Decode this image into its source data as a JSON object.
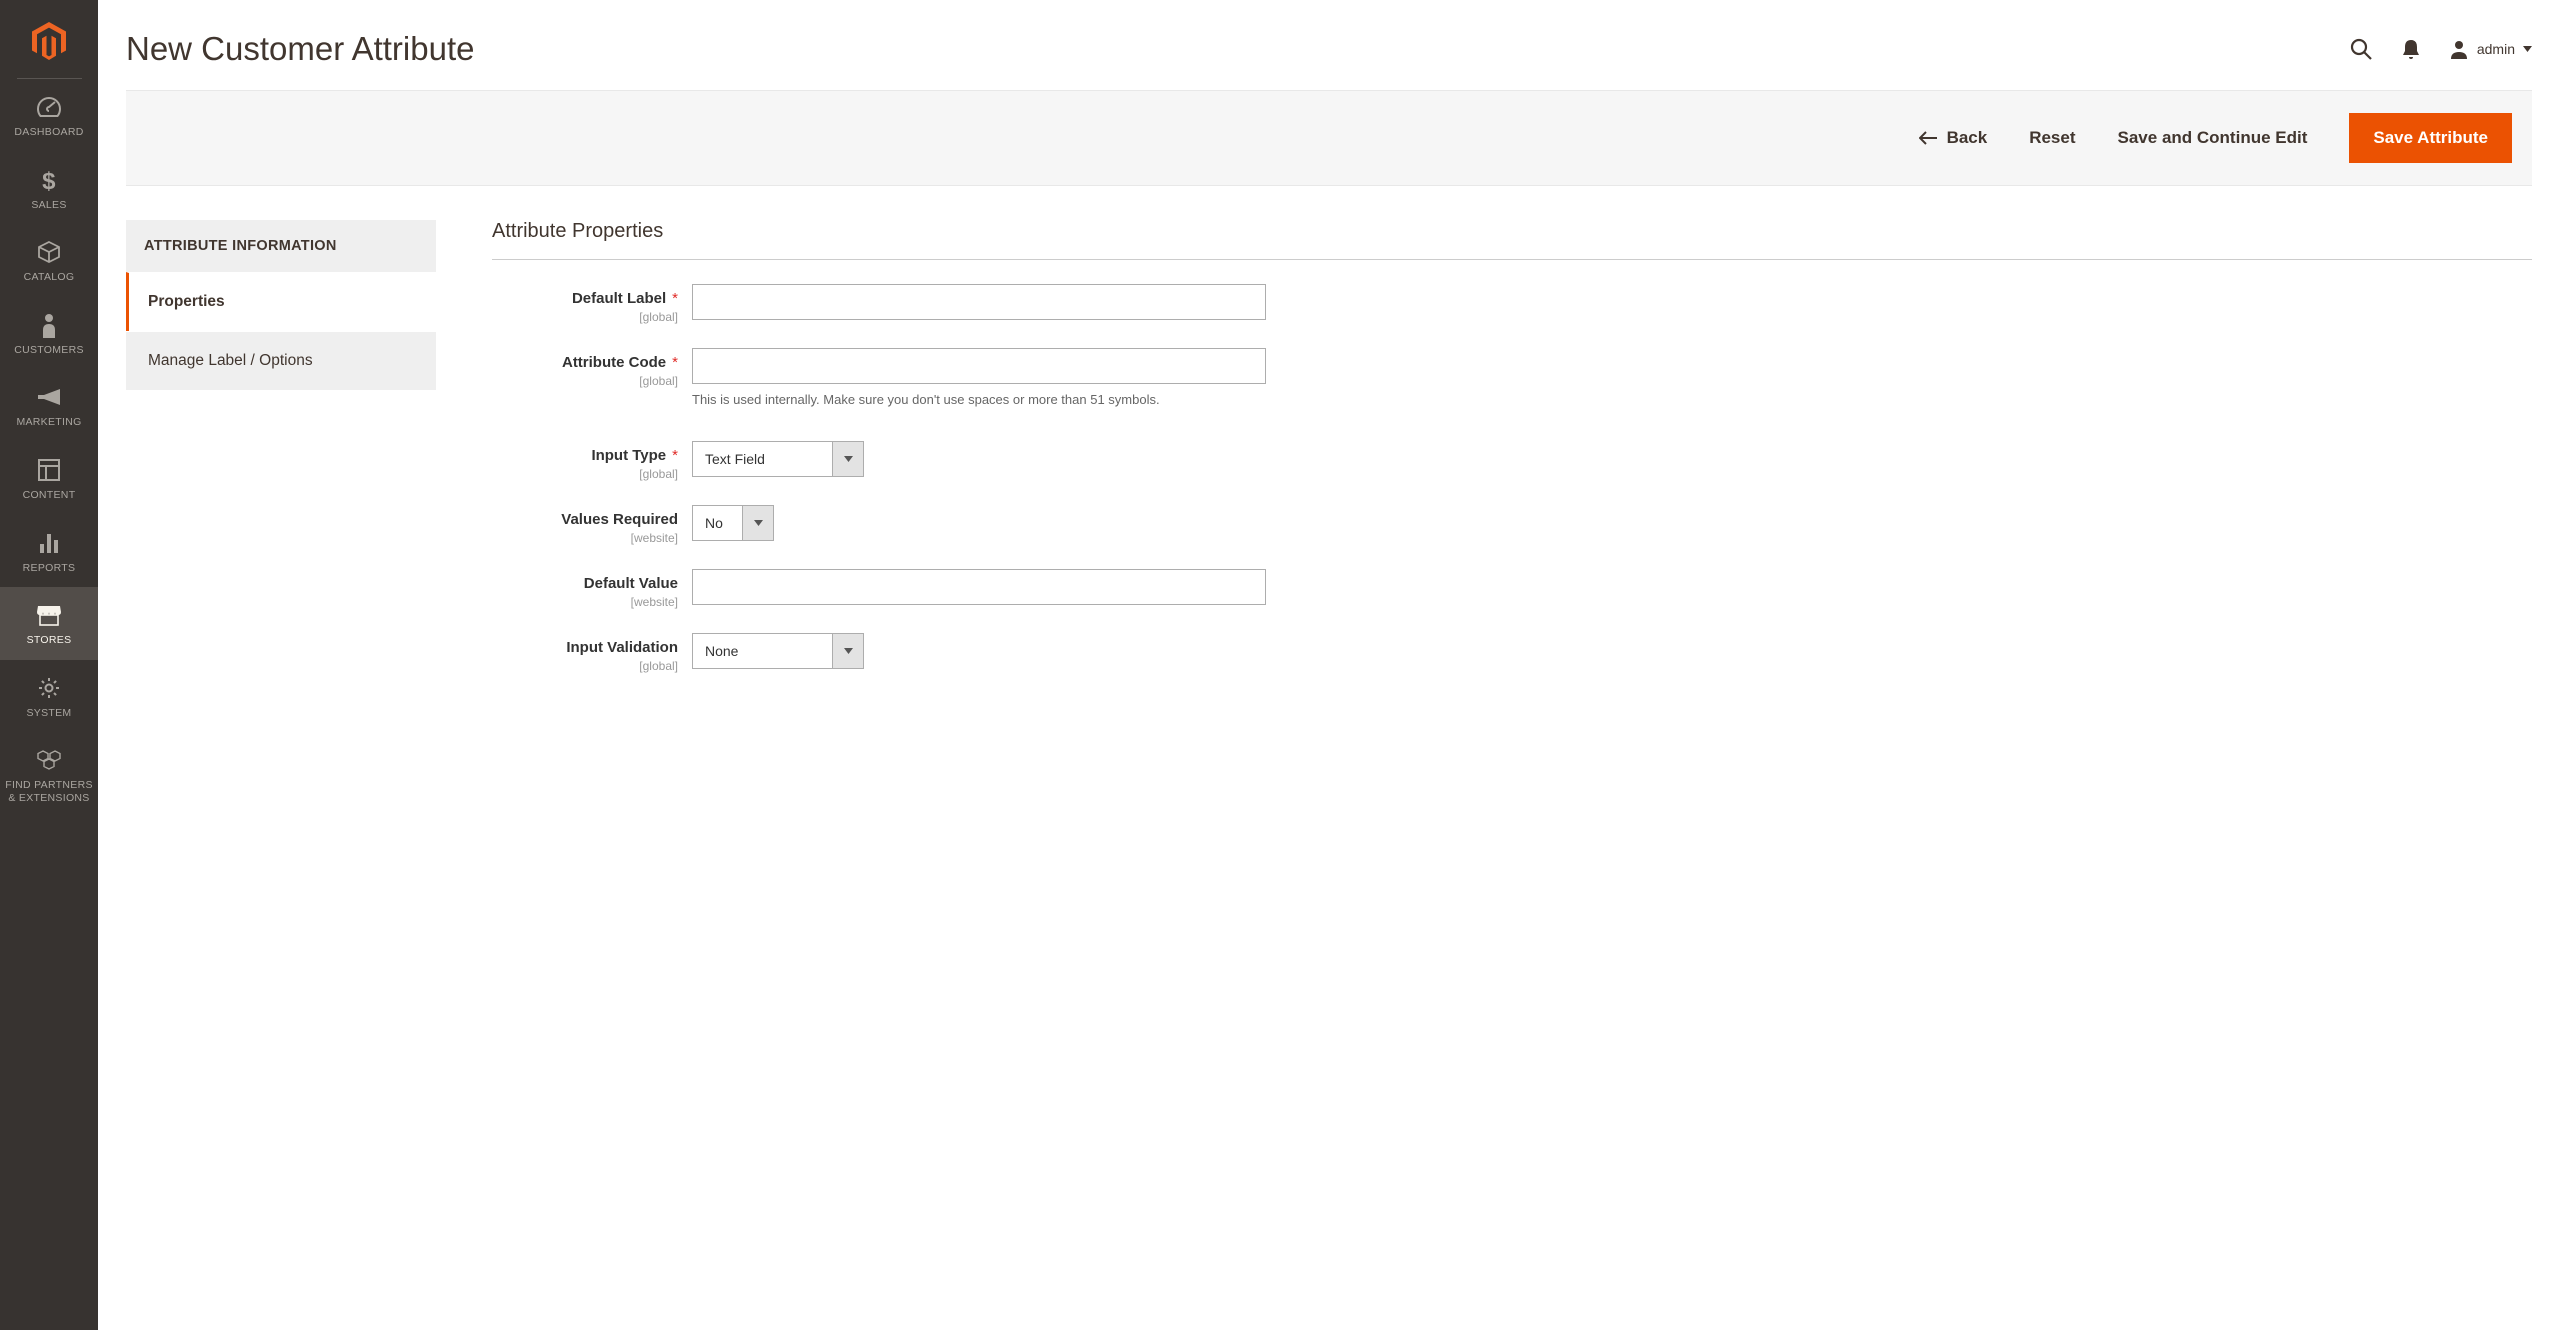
{
  "header": {
    "title": "New Customer Attribute",
    "user_label": "admin"
  },
  "nav": {
    "items": [
      {
        "label": "DASHBOARD"
      },
      {
        "label": "SALES"
      },
      {
        "label": "CATALOG"
      },
      {
        "label": "CUSTOMERS"
      },
      {
        "label": "MARKETING"
      },
      {
        "label": "CONTENT"
      },
      {
        "label": "REPORTS"
      },
      {
        "label": "STORES"
      },
      {
        "label": "SYSTEM"
      },
      {
        "label": "FIND PARTNERS & EXTENSIONS"
      }
    ]
  },
  "action_bar": {
    "back": "Back",
    "reset": "Reset",
    "save_continue": "Save and Continue Edit",
    "save": "Save Attribute"
  },
  "tabs": {
    "heading": "ATTRIBUTE INFORMATION",
    "properties": "Properties",
    "manage": "Manage Label / Options"
  },
  "form": {
    "section_title": "Attribute Properties",
    "default_label": {
      "label": "Default Label",
      "scope": "[global]",
      "value": ""
    },
    "attribute_code": {
      "label": "Attribute Code",
      "scope": "[global]",
      "value": "",
      "help": "This is used internally. Make sure you don't use spaces or more than 51 symbols."
    },
    "input_type": {
      "label": "Input Type",
      "scope": "[global]",
      "value": "Text Field"
    },
    "values_required": {
      "label": "Values Required",
      "scope": "[website]",
      "value": "No"
    },
    "default_value": {
      "label": "Default Value",
      "scope": "[website]",
      "value": ""
    },
    "input_validation": {
      "label": "Input Validation",
      "scope": "[global]",
      "value": "None"
    }
  },
  "colors": {
    "brand_orange": "#eb5202",
    "sidebar_bg": "#373330"
  }
}
